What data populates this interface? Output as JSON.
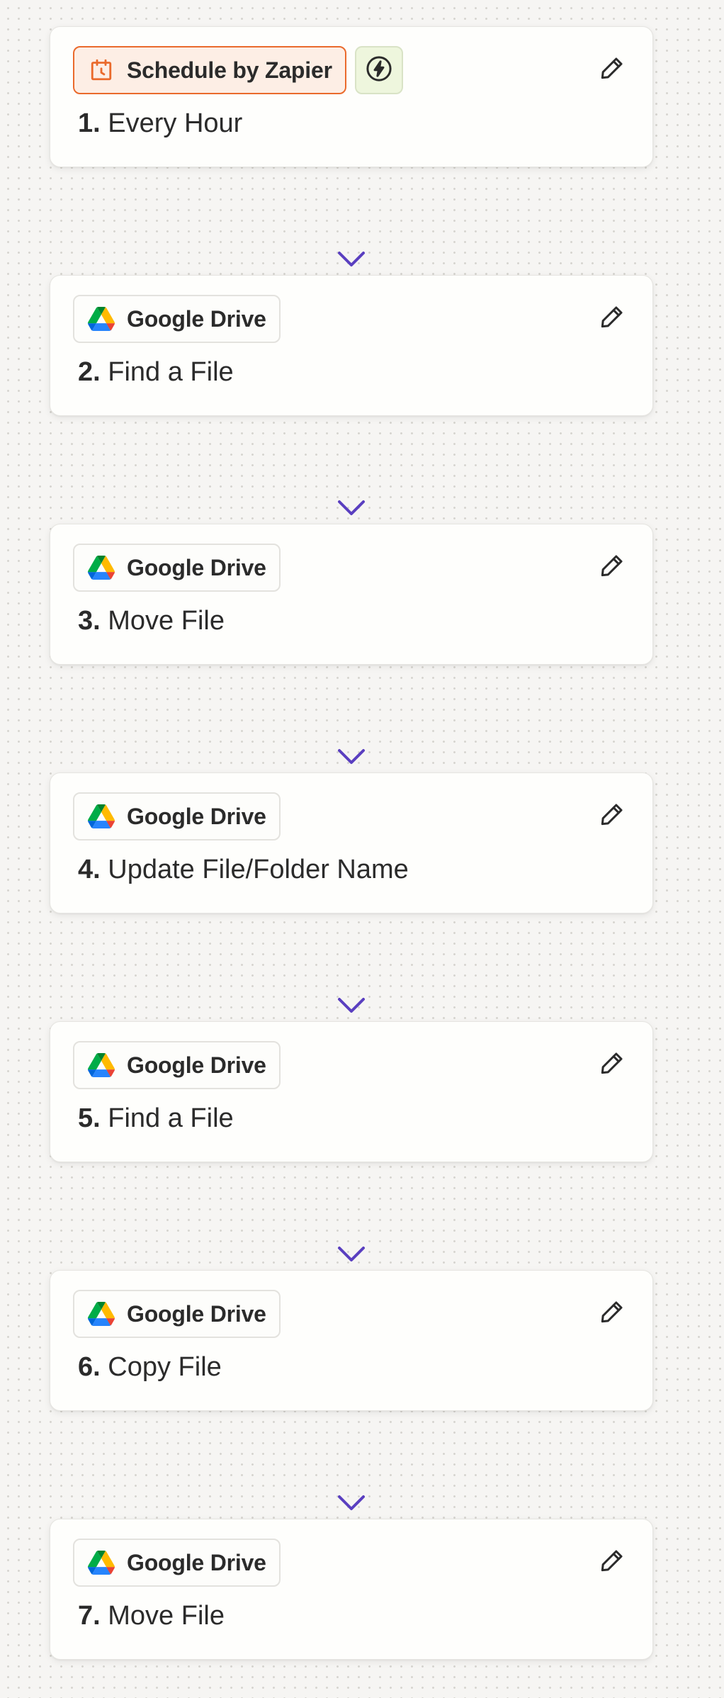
{
  "colors": {
    "connector": "#5a3fc0",
    "connector_light": "#b8acec",
    "schedule_accent": "#ea6a2c",
    "trigger_chip": "#eef6dd"
  },
  "steps": [
    {
      "number": "1.",
      "title": "Every Hour",
      "app": "Schedule by Zapier",
      "app_icon": "calendar-clock-icon",
      "is_trigger": true,
      "trigger_icon": "lightning-bolt-icon",
      "edit_icon": "pencil-icon"
    },
    {
      "number": "2.",
      "title": "Find a File",
      "app": "Google Drive",
      "app_icon": "google-drive-icon",
      "edit_icon": "pencil-icon"
    },
    {
      "number": "3.",
      "title": "Move File",
      "app": "Google Drive",
      "app_icon": "google-drive-icon",
      "edit_icon": "pencil-icon"
    },
    {
      "number": "4.",
      "title": "Update File/Folder Name",
      "app": "Google Drive",
      "app_icon": "google-drive-icon",
      "edit_icon": "pencil-icon"
    },
    {
      "number": "5.",
      "title": "Find a File",
      "app": "Google Drive",
      "app_icon": "google-drive-icon",
      "edit_icon": "pencil-icon"
    },
    {
      "number": "6.",
      "title": "Copy File",
      "app": "Google Drive",
      "app_icon": "google-drive-icon",
      "edit_icon": "pencil-icon"
    },
    {
      "number": "7.",
      "title": "Move File",
      "app": "Google Drive",
      "app_icon": "google-drive-icon",
      "edit_icon": "pencil-icon"
    }
  ]
}
